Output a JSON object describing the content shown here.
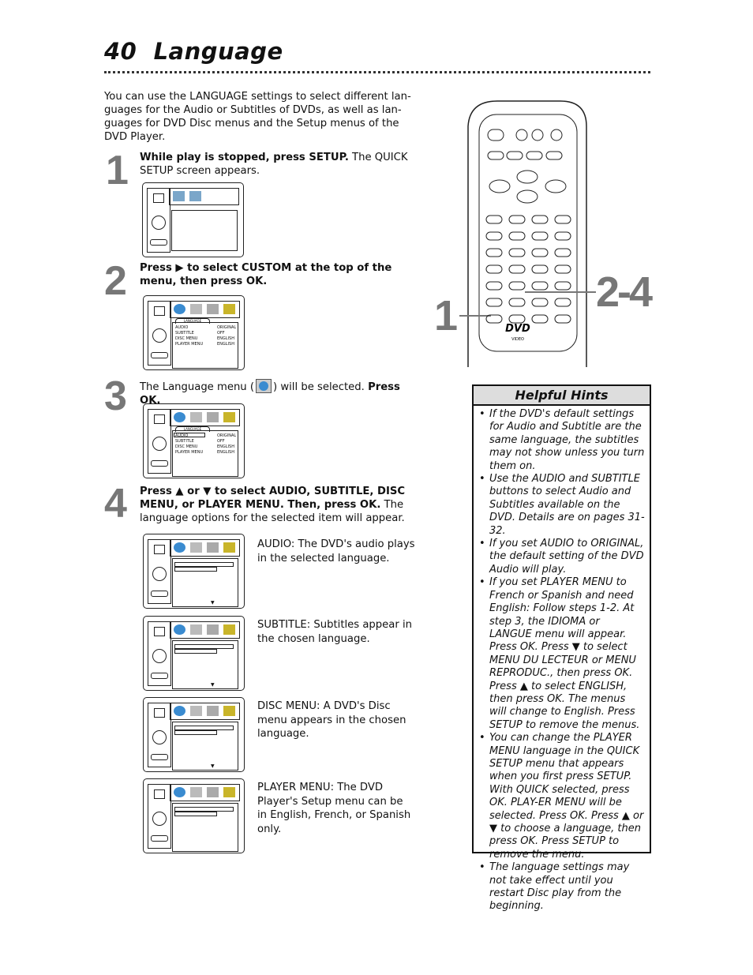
{
  "page": {
    "number": "40",
    "title": "Language"
  },
  "intro": "You can use the LANGUAGE settings to select different lan-guages for the Audio or Subtitles of DVDs, as well as lan-guages for DVD Disc menus and the Setup menus of the DVD Player.",
  "steps": [
    {
      "num": "1",
      "bold": "While play is stopped, press SETUP.",
      "text": " The QUICK SETUP screen appears."
    },
    {
      "num": "2",
      "bold": "Press ▶ to select CUSTOM at the top of the menu, then press OK.",
      "text": ""
    },
    {
      "num": "3",
      "pre": "The Language menu (",
      "post": ") will be selected. ",
      "bold": "Press OK."
    },
    {
      "num": "4",
      "bold": "Press ▲ or ▼ to select AUDIO, SUBTITLE, DISC MENU, or PLAYER MENU. Then, press OK.",
      "text": " The language options for the selected item will appear."
    }
  ],
  "menu": {
    "tab": "LANGUAGE",
    "rows": [
      [
        "AUDIO",
        "ORIGINAL"
      ],
      [
        "SUBTITLE",
        "OFF"
      ],
      [
        "DISC MENU",
        "ENGLISH"
      ],
      [
        "PLAYER MENU",
        "ENGLISH"
      ]
    ]
  },
  "captions": [
    "AUDIO: The DVD's audio plays in the selected language.",
    "SUBTITLE: Subtitles appear in the chosen language.",
    "DISC MENU: A DVD's Disc menu appears in the chosen language.",
    "PLAYER MENU: The DVD Player's Setup menu can be in English, French, or Spanish only."
  ],
  "remote": {
    "callout_1": "1",
    "callout_2": "2-4",
    "logo": "DVD",
    "logo_sub": "VIDEO"
  },
  "hints": {
    "title": "Helpful Hints",
    "items": [
      "If the DVD's default settings for Audio and Subtitle are the same language, the subtitles may not show unless you turn them on.",
      "Use the AUDIO and SUBTITLE buttons to select Audio and Subtitles available on the DVD. Details are on pages 31-32.",
      "If you set AUDIO to ORIGINAL, the default setting of the DVD Audio will play.",
      "If you set PLAYER MENU to French or Spanish and need English: Follow steps 1-2. At step 3, the IDIOMA or LANGUE menu will appear. Press OK. Press ▼ to select MENU DU LECTEUR or MENU REPRODUC., then press OK. Press ▲ to select ENGLISH, then press OK. The menus will change to English. Press SETUP to remove the menus.",
      "You can change the PLAYER MENU language in the QUICK SETUP menu that appears when you first press SETUP. With QUICK selected, press OK. PLAY-ER MENU will be selected. Press OK. Press ▲ or ▼ to choose a language, then press OK. Press SETUP to remove the menu.",
      "The language settings may not take effect until you restart Disc play from the beginning."
    ]
  },
  "colors": {
    "step_number": "#777777",
    "hints_header": "#dddddd"
  }
}
